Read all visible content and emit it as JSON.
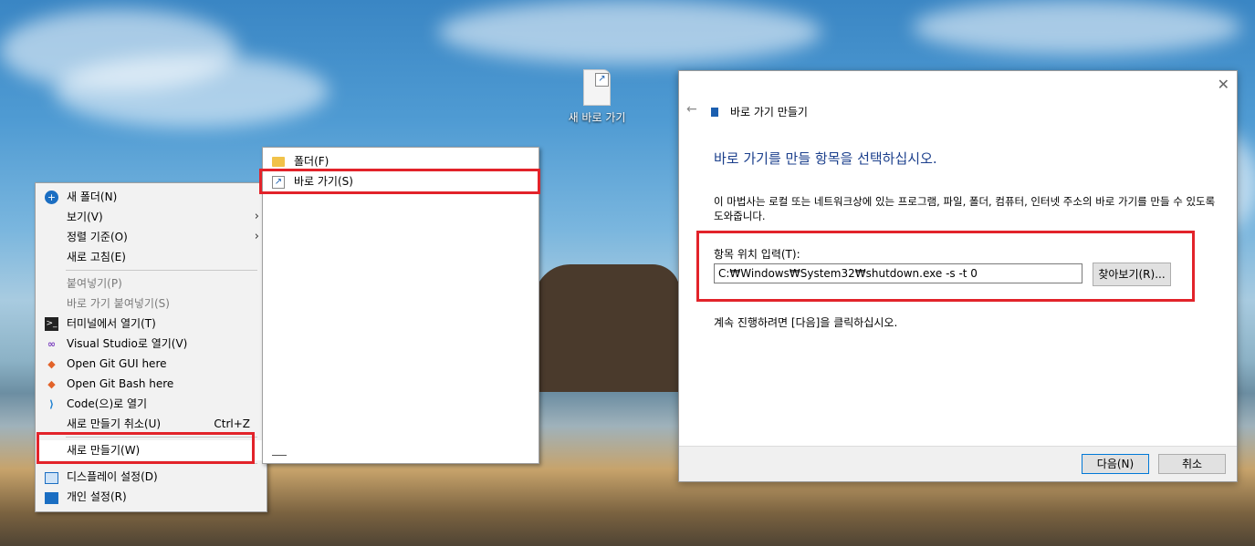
{
  "desktop": {
    "icon_label": "새 바로 가기"
  },
  "context_menu": {
    "items": [
      {
        "label": "새 폴더(N)",
        "icon": "new-folder-icon",
        "disabled": false
      },
      {
        "label": "보기(V)",
        "has_submenu": true
      },
      {
        "label": "정렬 기준(O)",
        "has_submenu": true
      },
      {
        "label": "새로 고침(E)"
      },
      {
        "label": "붙여넣기(P)",
        "disabled": true
      },
      {
        "label": "바로 가기 붙여넣기(S)",
        "disabled": true
      },
      {
        "label": "터미널에서 열기(T)",
        "icon": "terminal-icon"
      },
      {
        "label": "Visual Studio로 열기(V)",
        "icon": "visual-studio-icon"
      },
      {
        "label": "Open Git GUI here",
        "icon": "git-icon"
      },
      {
        "label": "Open Git Bash here",
        "icon": "git-icon"
      },
      {
        "label": "Code(으)로 열기",
        "icon": "vscode-icon"
      },
      {
        "label": "새로 만들기 취소(U)",
        "shortcut": "Ctrl+Z"
      },
      {
        "label": "새로 만들기(W)",
        "has_submenu": true,
        "highlighted": true
      },
      {
        "label": "디스플레이 설정(D)",
        "icon": "display-icon"
      },
      {
        "label": "개인 설정(R)",
        "icon": "personalize-icon"
      }
    ]
  },
  "submenu": {
    "items": [
      {
        "label": "폴더(F)",
        "icon": "folder-icon"
      },
      {
        "label": "바로 가기(S)",
        "icon": "shortcut-icon",
        "highlighted": true
      }
    ]
  },
  "wizard": {
    "title": "바로 가기 만들기",
    "heading": "바로 가기를 만들 항목을 선택하십시오.",
    "description": "이 마법사는 로컬 또는 네트워크상에 있는 프로그램, 파일, 폴더, 컴퓨터, 인터넷 주소의 바로 가기를 만들 수 있도록 도와줍니다.",
    "location_label": "항목 위치 입력(T):",
    "location_value": "C:₩Windows₩System32₩shutdown.exe -s -t 0",
    "browse_label": "찾아보기(R)...",
    "continue_text": "계속 진행하려면 [다음]을 클릭하십시오.",
    "next_label": "다음(N)",
    "cancel_label": "취소"
  },
  "colors": {
    "highlight_border": "#e2232a",
    "heading": "#1b3f8c"
  }
}
